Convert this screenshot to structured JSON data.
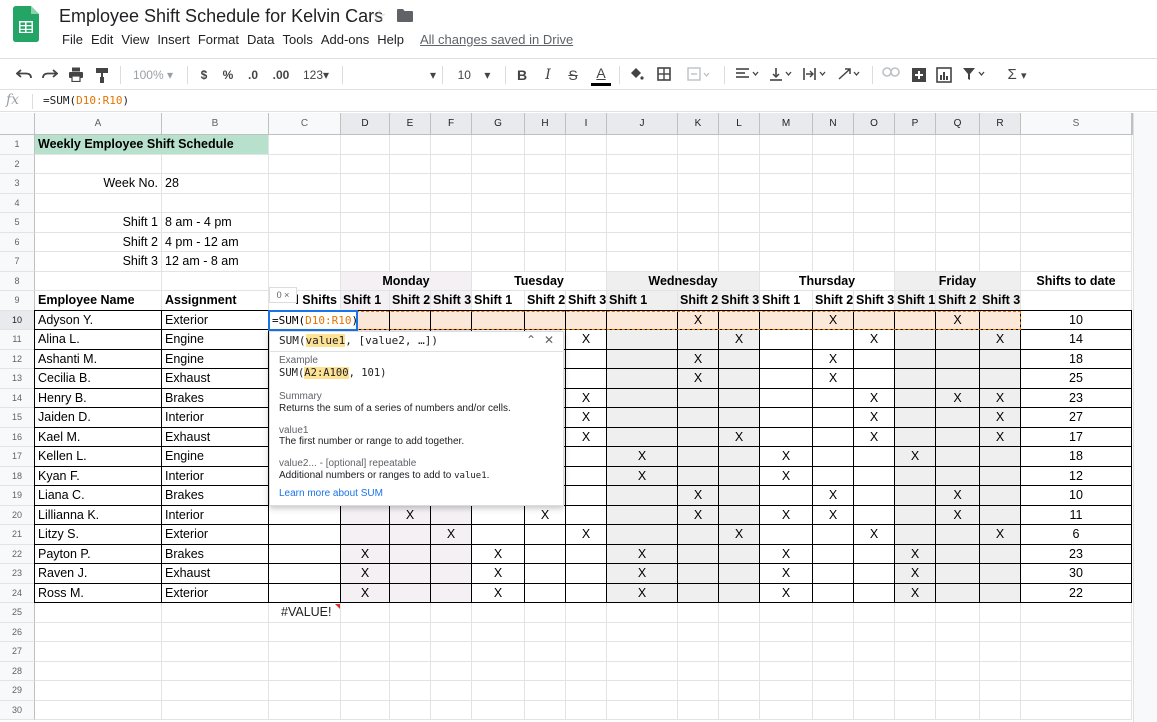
{
  "app": {
    "doc_title": "Employee Shift Schedule for Kelvin Cars",
    "save_status": "All changes saved in Drive",
    "menus": [
      "File",
      "Edit",
      "View",
      "Insert",
      "Format",
      "Data",
      "Tools",
      "Add-ons",
      "Help"
    ]
  },
  "toolbar": {
    "zoom": "100%",
    "currency": "$",
    "percent": "%",
    "dec_less": ".0",
    "dec_more": ".00",
    "number_format": "123",
    "font_size": "10",
    "bold": "B",
    "italic": "I",
    "strike": "S",
    "text_color": "A",
    "sum": "Σ"
  },
  "formula_bar": {
    "fx": "fx",
    "prefix": "=SUM(",
    "range": "D10:R10",
    "suffix": ")"
  },
  "columns": [
    "A",
    "B",
    "C",
    "D",
    "E",
    "F",
    "G",
    "H",
    "I",
    "J",
    "K",
    "L",
    "M",
    "N",
    "O",
    "P",
    "Q",
    "R",
    "S"
  ],
  "rows": [
    "1",
    "2",
    "3",
    "4",
    "5",
    "6",
    "7",
    "8",
    "9",
    "10",
    "11",
    "12",
    "13",
    "14",
    "15",
    "16",
    "17",
    "18",
    "19",
    "20",
    "21",
    "22",
    "23",
    "24",
    "25",
    "26",
    "27",
    "28",
    "29",
    "30"
  ],
  "sheet": {
    "title": "Weekly Employee Shift Schedule",
    "week_label": "Week No.",
    "week_value": "28",
    "shifts": [
      {
        "label": "Shift 1",
        "time": "8 am - 4 pm"
      },
      {
        "label": "Shift 2",
        "time": "4 pm - 12 am"
      },
      {
        "label": "Shift 3",
        "time": "12 am - 8 am"
      }
    ],
    "days": [
      "Monday",
      "Tuesday",
      "Wednesday",
      "Thursday",
      "Friday"
    ],
    "shifts_to_date_header": "Shifts to date",
    "employee_header": "Employee Name",
    "assignment_header": "Assignment",
    "total_header": "l Shifts",
    "shift_headers": [
      "Shift 1",
      "Shift 2",
      "Shift 3"
    ],
    "mark": "X",
    "editing_formula_prefix": "=SUM(",
    "editing_formula_range": "D10:R10",
    "editing_formula_suffix": ")",
    "error_value": "#VALUE!",
    "employees": [
      {
        "name": "Adyson Y.",
        "assignment": "Exterior",
        "marks": [
          7,
          10,
          13
        ],
        "to_date": "10"
      },
      {
        "name": "Alina L.",
        "assignment": "Engine",
        "marks": [
          5,
          8,
          11,
          14
        ],
        "to_date": "14"
      },
      {
        "name": "Ashanti M.",
        "assignment": "Engine",
        "marks": [
          7,
          10
        ],
        "to_date": "18"
      },
      {
        "name": "Cecilia B.",
        "assignment": "Exhaust",
        "marks": [
          7,
          10
        ],
        "to_date": "25"
      },
      {
        "name": "Henry B.",
        "assignment": "Brakes",
        "marks": [
          5,
          11,
          13,
          14
        ],
        "to_date": "23"
      },
      {
        "name": "Jaiden D.",
        "assignment": "Interior",
        "marks": [
          5,
          11,
          14
        ],
        "to_date": "27"
      },
      {
        "name": "Kael M.",
        "assignment": "Exhaust",
        "marks": [
          5,
          8,
          11,
          14
        ],
        "to_date": "17"
      },
      {
        "name": "Kellen L.",
        "assignment": "Engine",
        "marks": [
          6,
          9,
          12
        ],
        "to_date": "18"
      },
      {
        "name": "Kyan F.",
        "assignment": "Interior",
        "marks": [
          6,
          9
        ],
        "to_date": "12"
      },
      {
        "name": "Liana C.",
        "assignment": "Brakes",
        "marks": [
          7,
          10,
          13
        ],
        "to_date": "10"
      },
      {
        "name": "Lillianna K.",
        "assignment": "Interior",
        "marks": [
          1,
          4,
          7,
          9,
          10,
          13
        ],
        "to_date": "11"
      },
      {
        "name": "Litzy S.",
        "assignment": "Exterior",
        "marks": [
          2,
          5,
          8,
          11,
          14
        ],
        "to_date": "6"
      },
      {
        "name": "Payton P.",
        "assignment": "Brakes",
        "marks": [
          0,
          3,
          6,
          9,
          12
        ],
        "to_date": "23"
      },
      {
        "name": "Raven J.",
        "assignment": "Exhaust",
        "marks": [
          0,
          3,
          6,
          9,
          12
        ],
        "to_date": "30"
      },
      {
        "name": "Ross M.",
        "assignment": "Exterior",
        "marks": [
          0,
          3,
          6,
          9,
          12
        ],
        "to_date": "22"
      }
    ]
  },
  "popup": {
    "sig_prefix": "SUM(",
    "sig_arg1": "value1",
    "sig_rest": ", [value2, …])",
    "example_label": "Example",
    "example_prefix": "SUM(",
    "example_range": "A2:A100",
    "example_suffix": ", 101)",
    "summary_label": "Summary",
    "summary_text": "Returns the sum of a series of numbers and/or cells.",
    "arg1_name": "value1",
    "arg1_desc": "The first number or range to add together.",
    "arg2_name": "value2... - [optional] repeatable",
    "arg2_desc_prefix": "Additional numbers or ranges to add to ",
    "arg2_desc_code": "value1",
    "arg2_desc_suffix": ".",
    "learn_more": "Learn more about SUM",
    "mini_value": "0",
    "mini_close": "×"
  }
}
